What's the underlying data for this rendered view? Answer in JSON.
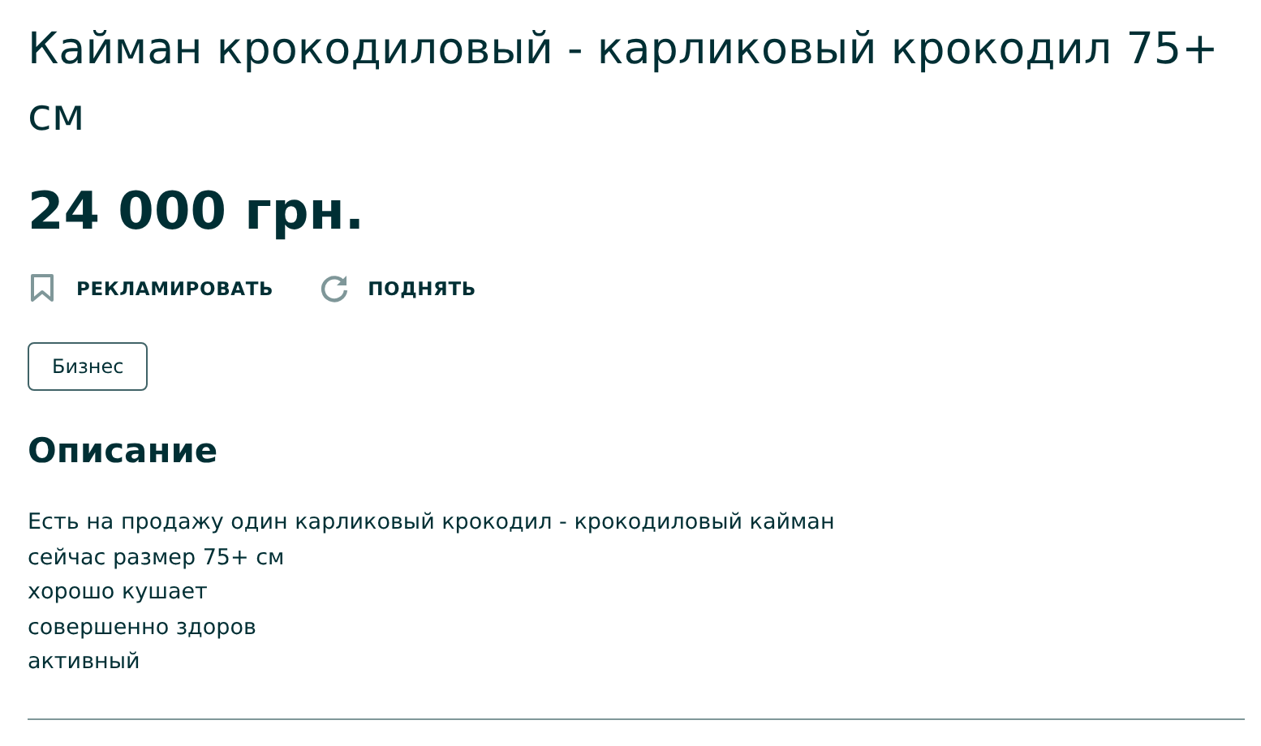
{
  "title": "Кайман крокодиловый - карликовый крокодил 75+ см",
  "price": "24 000 грн.",
  "actions": [
    {
      "kind": "promote",
      "label": "РЕКЛАМИРОВАТЬ"
    },
    {
      "kind": "raise",
      "label": "ПОДНЯТЬ"
    }
  ],
  "tag": "Бизнес",
  "description": {
    "heading": "Описание",
    "lines": [
      "Есть на продажу один карликовый крокодил - крокодиловый кайман",
      "сейчас размер 75+ см",
      "хорошо кушает",
      "совершенно здоров",
      "активный"
    ]
  }
}
